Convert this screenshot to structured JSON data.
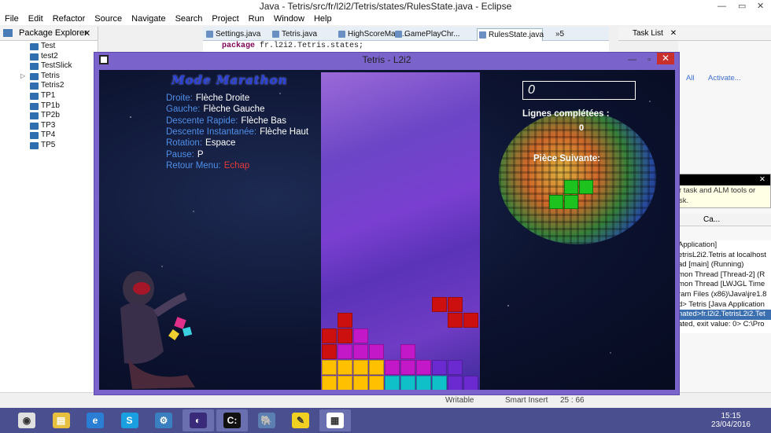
{
  "eclipse": {
    "title": "Java - Tetris/src/fr/l2i2/Tetris/states/RulesState.java - Eclipse",
    "menu": [
      "File",
      "Edit",
      "Refactor",
      "Source",
      "Navigate",
      "Search",
      "Project",
      "Run",
      "Window",
      "Help"
    ],
    "package_explorer": {
      "title": "Package Explorer",
      "projects": [
        "Test",
        "test2",
        "TestSlick",
        "Tetris",
        "Tetris2",
        "TP1",
        "TP1b",
        "TP2b",
        "TP3",
        "TP4",
        "TP5"
      ]
    },
    "editor_tabs": [
      "Settings.java",
      "Tetris.java",
      "HighScoreMan...",
      "GamePlayChr...",
      "RulesState.java"
    ],
    "editor_tabs_overflow": "»5",
    "code_line": {
      "keyword": "package",
      "text": " fr.l2i2.Tetris.states;"
    },
    "task_list_title": "Task List",
    "task_links": [
      "All",
      "Activate..."
    ],
    "tooltip": {
      "line1": "r task and ALM tools or",
      "line2": "sk."
    },
    "console_tab": "Ca...",
    "console_lines": [
      "Application]",
      "etrisL2i2.Tetris at localhost",
      "ad [main] (Running)",
      "mon Thread [Thread-2] (R",
      "mon Thread [LWJGL Time",
      "ram Files (x86)\\Java\\jre1.8",
      "d> Tetris [Java Application",
      "nated>fr.l2i2.TetrisL2i2.Tet",
      "ated, exit value: 0> C:\\Pro"
    ],
    "status": {
      "writable": "Writable",
      "insert": "Smart Insert",
      "position": "25 : 66"
    }
  },
  "tetris": {
    "window_title": "Tetris - L2i2",
    "mode_title": "Mode Marathon",
    "controls": [
      {
        "key": "Droite:",
        "value": "Flèche Droite"
      },
      {
        "key": "Gauche:",
        "value": "Flèche Gauche"
      },
      {
        "key": "Descente Rapide:",
        "value": "Flèche Bas"
      },
      {
        "key": "Descente Instantanée:",
        "value": "Flèche Haut"
      },
      {
        "key": "Rotation:",
        "value": "Espace"
      },
      {
        "key": "Pause:",
        "value": "P"
      },
      {
        "key": "Retour Menu:",
        "value": "Echap"
      }
    ],
    "score": "0",
    "lines_label": "Lignes complétées :",
    "lines_value": "0",
    "next_piece_label": "Pièce Suivante:",
    "colors": {
      "red": "#cc1010",
      "magenta": "#c218c8",
      "yellow": "#ffc000",
      "cyan": "#10c0c8",
      "purple": "#6a2ad0",
      "green": "#1ec21e"
    },
    "board_cells": [
      {
        "c": 7,
        "r": 14,
        "col": "red"
      },
      {
        "c": 8,
        "r": 14,
        "col": "red"
      },
      {
        "c": 8,
        "r": 15,
        "col": "red"
      },
      {
        "c": 9,
        "r": 15,
        "col": "red"
      },
      {
        "c": 1,
        "r": 15,
        "col": "red"
      },
      {
        "c": 0,
        "r": 16,
        "col": "red"
      },
      {
        "c": 1,
        "r": 16,
        "col": "red"
      },
      {
        "c": 2,
        "r": 16,
        "col": "magenta"
      },
      {
        "c": 0,
        "r": 17,
        "col": "red"
      },
      {
        "c": 1,
        "r": 17,
        "col": "magenta"
      },
      {
        "c": 2,
        "r": 17,
        "col": "magenta"
      },
      {
        "c": 3,
        "r": 17,
        "col": "magenta"
      },
      {
        "c": 5,
        "r": 17,
        "col": "magenta"
      },
      {
        "c": 0,
        "r": 18,
        "col": "yellow"
      },
      {
        "c": 1,
        "r": 18,
        "col": "yellow"
      },
      {
        "c": 2,
        "r": 18,
        "col": "yellow"
      },
      {
        "c": 3,
        "r": 18,
        "col": "yellow"
      },
      {
        "c": 4,
        "r": 18,
        "col": "magenta"
      },
      {
        "c": 5,
        "r": 18,
        "col": "magenta"
      },
      {
        "c": 6,
        "r": 18,
        "col": "magenta"
      },
      {
        "c": 7,
        "r": 18,
        "col": "purple"
      },
      {
        "c": 8,
        "r": 18,
        "col": "purple"
      },
      {
        "c": 0,
        "r": 19,
        "col": "yellow"
      },
      {
        "c": 1,
        "r": 19,
        "col": "yellow"
      },
      {
        "c": 2,
        "r": 19,
        "col": "yellow"
      },
      {
        "c": 3,
        "r": 19,
        "col": "yellow"
      },
      {
        "c": 4,
        "r": 19,
        "col": "cyan"
      },
      {
        "c": 5,
        "r": 19,
        "col": "cyan"
      },
      {
        "c": 6,
        "r": 19,
        "col": "cyan"
      },
      {
        "c": 7,
        "r": 19,
        "col": "cyan"
      },
      {
        "c": 8,
        "r": 19,
        "col": "purple"
      },
      {
        "c": 9,
        "r": 19,
        "col": "purple"
      }
    ],
    "next_piece_cells": [
      {
        "c": 1,
        "r": 0
      },
      {
        "c": 2,
        "r": 0
      },
      {
        "c": 0,
        "r": 1
      },
      {
        "c": 1,
        "r": 1
      }
    ]
  },
  "taskbar": {
    "apps": [
      "chrome-icon",
      "file-explorer-icon",
      "internet-explorer-icon",
      "skype-icon",
      "network-icon",
      "eclipse-icon",
      "cmd-icon",
      "postgres-icon",
      "paint-icon",
      "tetris-icon"
    ],
    "time": "15:15",
    "date": "23/04/2016"
  }
}
